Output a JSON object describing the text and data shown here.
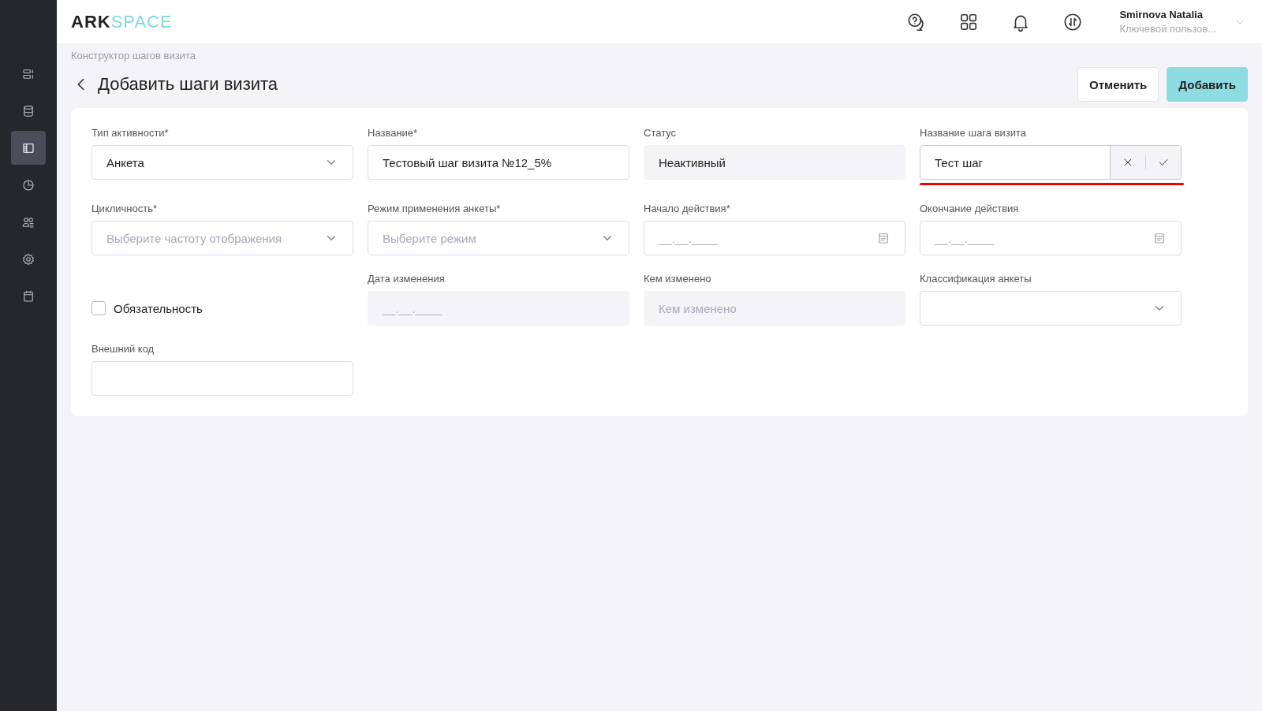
{
  "header": {
    "logo": {
      "part_1": "ARK",
      "part_2": "SPACE"
    },
    "user": {
      "name": "Smirnova Natalia",
      "role": "Ключевой пользов..."
    }
  },
  "sidebar": {
    "items": [
      {
        "kind": "list",
        "selected": false
      },
      {
        "kind": "database",
        "selected": false
      },
      {
        "kind": "panel",
        "selected": true
      },
      {
        "kind": "chart",
        "selected": false
      },
      {
        "kind": "users",
        "selected": false
      },
      {
        "kind": "settings",
        "selected": false
      },
      {
        "kind": "calendar",
        "selected": false
      }
    ]
  },
  "breadcrumb": "Конструктор шагов визита",
  "title": "Добавить шаги визита",
  "buttons": [
    {
      "label": "Отменить",
      "kind": "secondary"
    },
    {
      "label": "Добавить",
      "kind": "primary"
    }
  ],
  "form": {
    "fields": [
      {
        "kind": "select",
        "label": "Тип активности*",
        "value": "Анкета"
      },
      {
        "kind": "text",
        "label": "Название*",
        "value": "Тестовый шаг визита №12_5%"
      },
      {
        "kind": "readonly",
        "label": "Статус",
        "value": "Неактивный"
      },
      {
        "kind": "inline-edit",
        "label": "Название шага визита",
        "value": "Тест шаг",
        "invalid": true
      },
      {
        "kind": "select",
        "label": "Цикличность*",
        "placeholder": "Выберите частоту отображения"
      },
      {
        "kind": "select",
        "label": "Режим применения анкеты*",
        "placeholder": "Выберите режим"
      },
      {
        "kind": "date",
        "label": "Начало действия*",
        "placeholder": "__.__.____"
      },
      {
        "kind": "date",
        "label": "Окончание действия",
        "placeholder": "__.__.____"
      },
      {
        "kind": "checkbox",
        "label": "Обязательность",
        "checked": false
      },
      {
        "kind": "readonly",
        "label": "Дата изменения",
        "placeholder": "__.__.____"
      },
      {
        "kind": "readonly",
        "label": "Кем изменено",
        "placeholder": "Кем изменено"
      },
      {
        "kind": "select",
        "label": "Классификация анкеты"
      },
      {
        "kind": "text",
        "label": "Внешний код"
      }
    ]
  }
}
